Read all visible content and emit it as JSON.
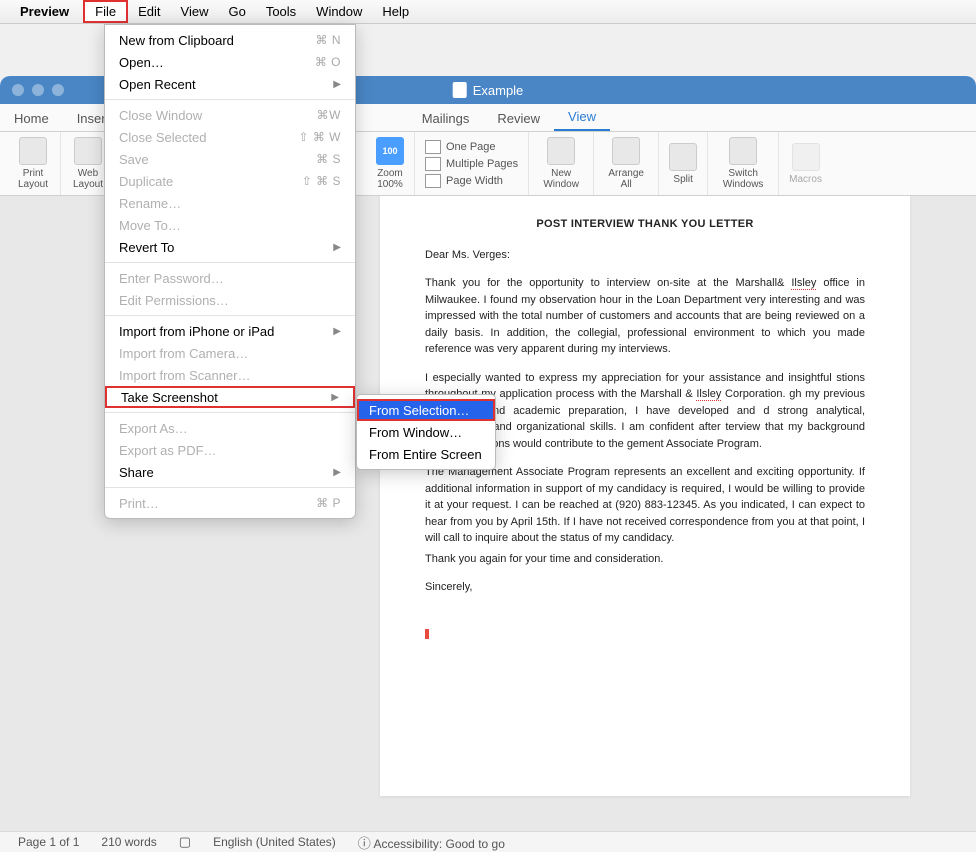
{
  "menubar": {
    "app_name": "Preview",
    "items": [
      "File",
      "Edit",
      "View",
      "Go",
      "Tools",
      "Window",
      "Help"
    ]
  },
  "file_menu": {
    "new_from_clipboard": "New from Clipboard",
    "new_from_clipboard_sc": "⌘ N",
    "open": "Open…",
    "open_sc": "⌘ O",
    "open_recent": "Open Recent",
    "close_window": "Close Window",
    "close_window_sc": "⌘W",
    "close_selected": "Close Selected",
    "close_selected_sc": "⇧ ⌘ W",
    "save": "Save",
    "save_sc": "⌘ S",
    "duplicate": "Duplicate",
    "duplicate_sc": "⇧ ⌘ S",
    "rename": "Rename…",
    "move_to": "Move To…",
    "revert_to": "Revert To",
    "enter_password": "Enter Password…",
    "edit_permissions": "Edit Permissions…",
    "import_iphone": "Import from iPhone or iPad",
    "import_camera": "Import from Camera…",
    "import_scanner": "Import from Scanner…",
    "take_screenshot": "Take Screenshot",
    "export_as": "Export As…",
    "export_pdf": "Export as PDF…",
    "share": "Share",
    "print": "Print…",
    "print_sc": "⌘ P"
  },
  "screenshot_submenu": {
    "from_selection": "From Selection…",
    "from_window": "From Window…",
    "from_entire": "From Entire Screen"
  },
  "window": {
    "title": "Example"
  },
  "ribbon_tabs": [
    "Home",
    "Insert",
    "Mailings",
    "Review",
    "View"
  ],
  "ribbon": {
    "print_layout": "Print Layout",
    "web_layout": "Web Layout",
    "zoom": "Zoom",
    "zoom_pct": "100%",
    "one_page": "One Page",
    "multiple_pages": "Multiple Pages",
    "page_width": "Page Width",
    "new_window": "New Window",
    "arrange_all": "Arrange All",
    "split": "Split",
    "switch_windows": "Switch Windows",
    "macros": "Macros"
  },
  "document": {
    "heading": "POST INTERVIEW THANK YOU LETTER",
    "salutation": "Dear Ms. Verges:",
    "p1a": "Thank you for the opportunity to interview on-site at the Marshall& ",
    "p1_err1": "Ilsley",
    "p1b": " office in Milwaukee. I found my observation hour in the Loan Department very interesting and was impressed with the total number of customers and accounts that are being reviewed on a daily basis. In addition, the collegial, professional environment to which you made reference was very apparent during my interviews.",
    "p2a": "I especially wanted to express my appreciation for your assistance and insightful ",
    "p2a_cont": "stions throughout my application process with the Marshall & ",
    "p2_err1": "Ilsley",
    "p2b": " Corporation. ",
    "p2b_cont": "gh my previous experience and academic preparation, I have developed and ",
    "p2c_cont": "d strong analytical, interpersonal and organizational skills. I am confident after ",
    "p2d_cont": "terview that my background and qualifications would contribute to the ",
    "p2e_cont": "gement Associate Program.",
    "p3": "The Management Associate Program represents an excellent and exciting opportunity. If additional information in support of my candidacy is required, I would be willing to provide it at your request. I can be reached at (920) 883-12345. As you indicated, I can expect to hear from you by April 15th. If I have not received correspondence from you at that point, I will call to inquire about the status of my candidacy.",
    "p4": "Thank you again for your time and consideration.",
    "closing": "Sincerely,"
  },
  "statusbar": {
    "page": "Page 1 of 1",
    "words": "210 words",
    "language": "English (United States)",
    "accessibility": "Accessibility: Good to go"
  }
}
